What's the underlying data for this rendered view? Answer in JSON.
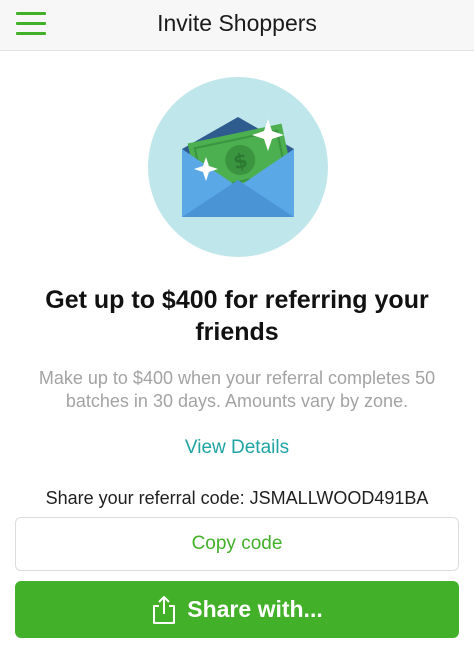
{
  "header": {
    "title": "Invite Shoppers",
    "menu_icon": "hamburger-menu-icon"
  },
  "hero": {
    "icon": "money-envelope-icon"
  },
  "content": {
    "headline": "Get up to $400 for referring your friends",
    "description": "Make up to $400 when your referral completes 50 batches in 30 days. Amounts vary by zone.",
    "details_link": "View Details",
    "referral_text": "Share your referral code: JSMALLWOOD491BA"
  },
  "actions": {
    "copy_label": "Copy code",
    "share_label": "Share with...",
    "share_icon": "share-icon"
  },
  "colors": {
    "brand_green": "#43b02a",
    "link_teal": "#1fa3a3",
    "hero_circle": "#bfe6ea"
  }
}
